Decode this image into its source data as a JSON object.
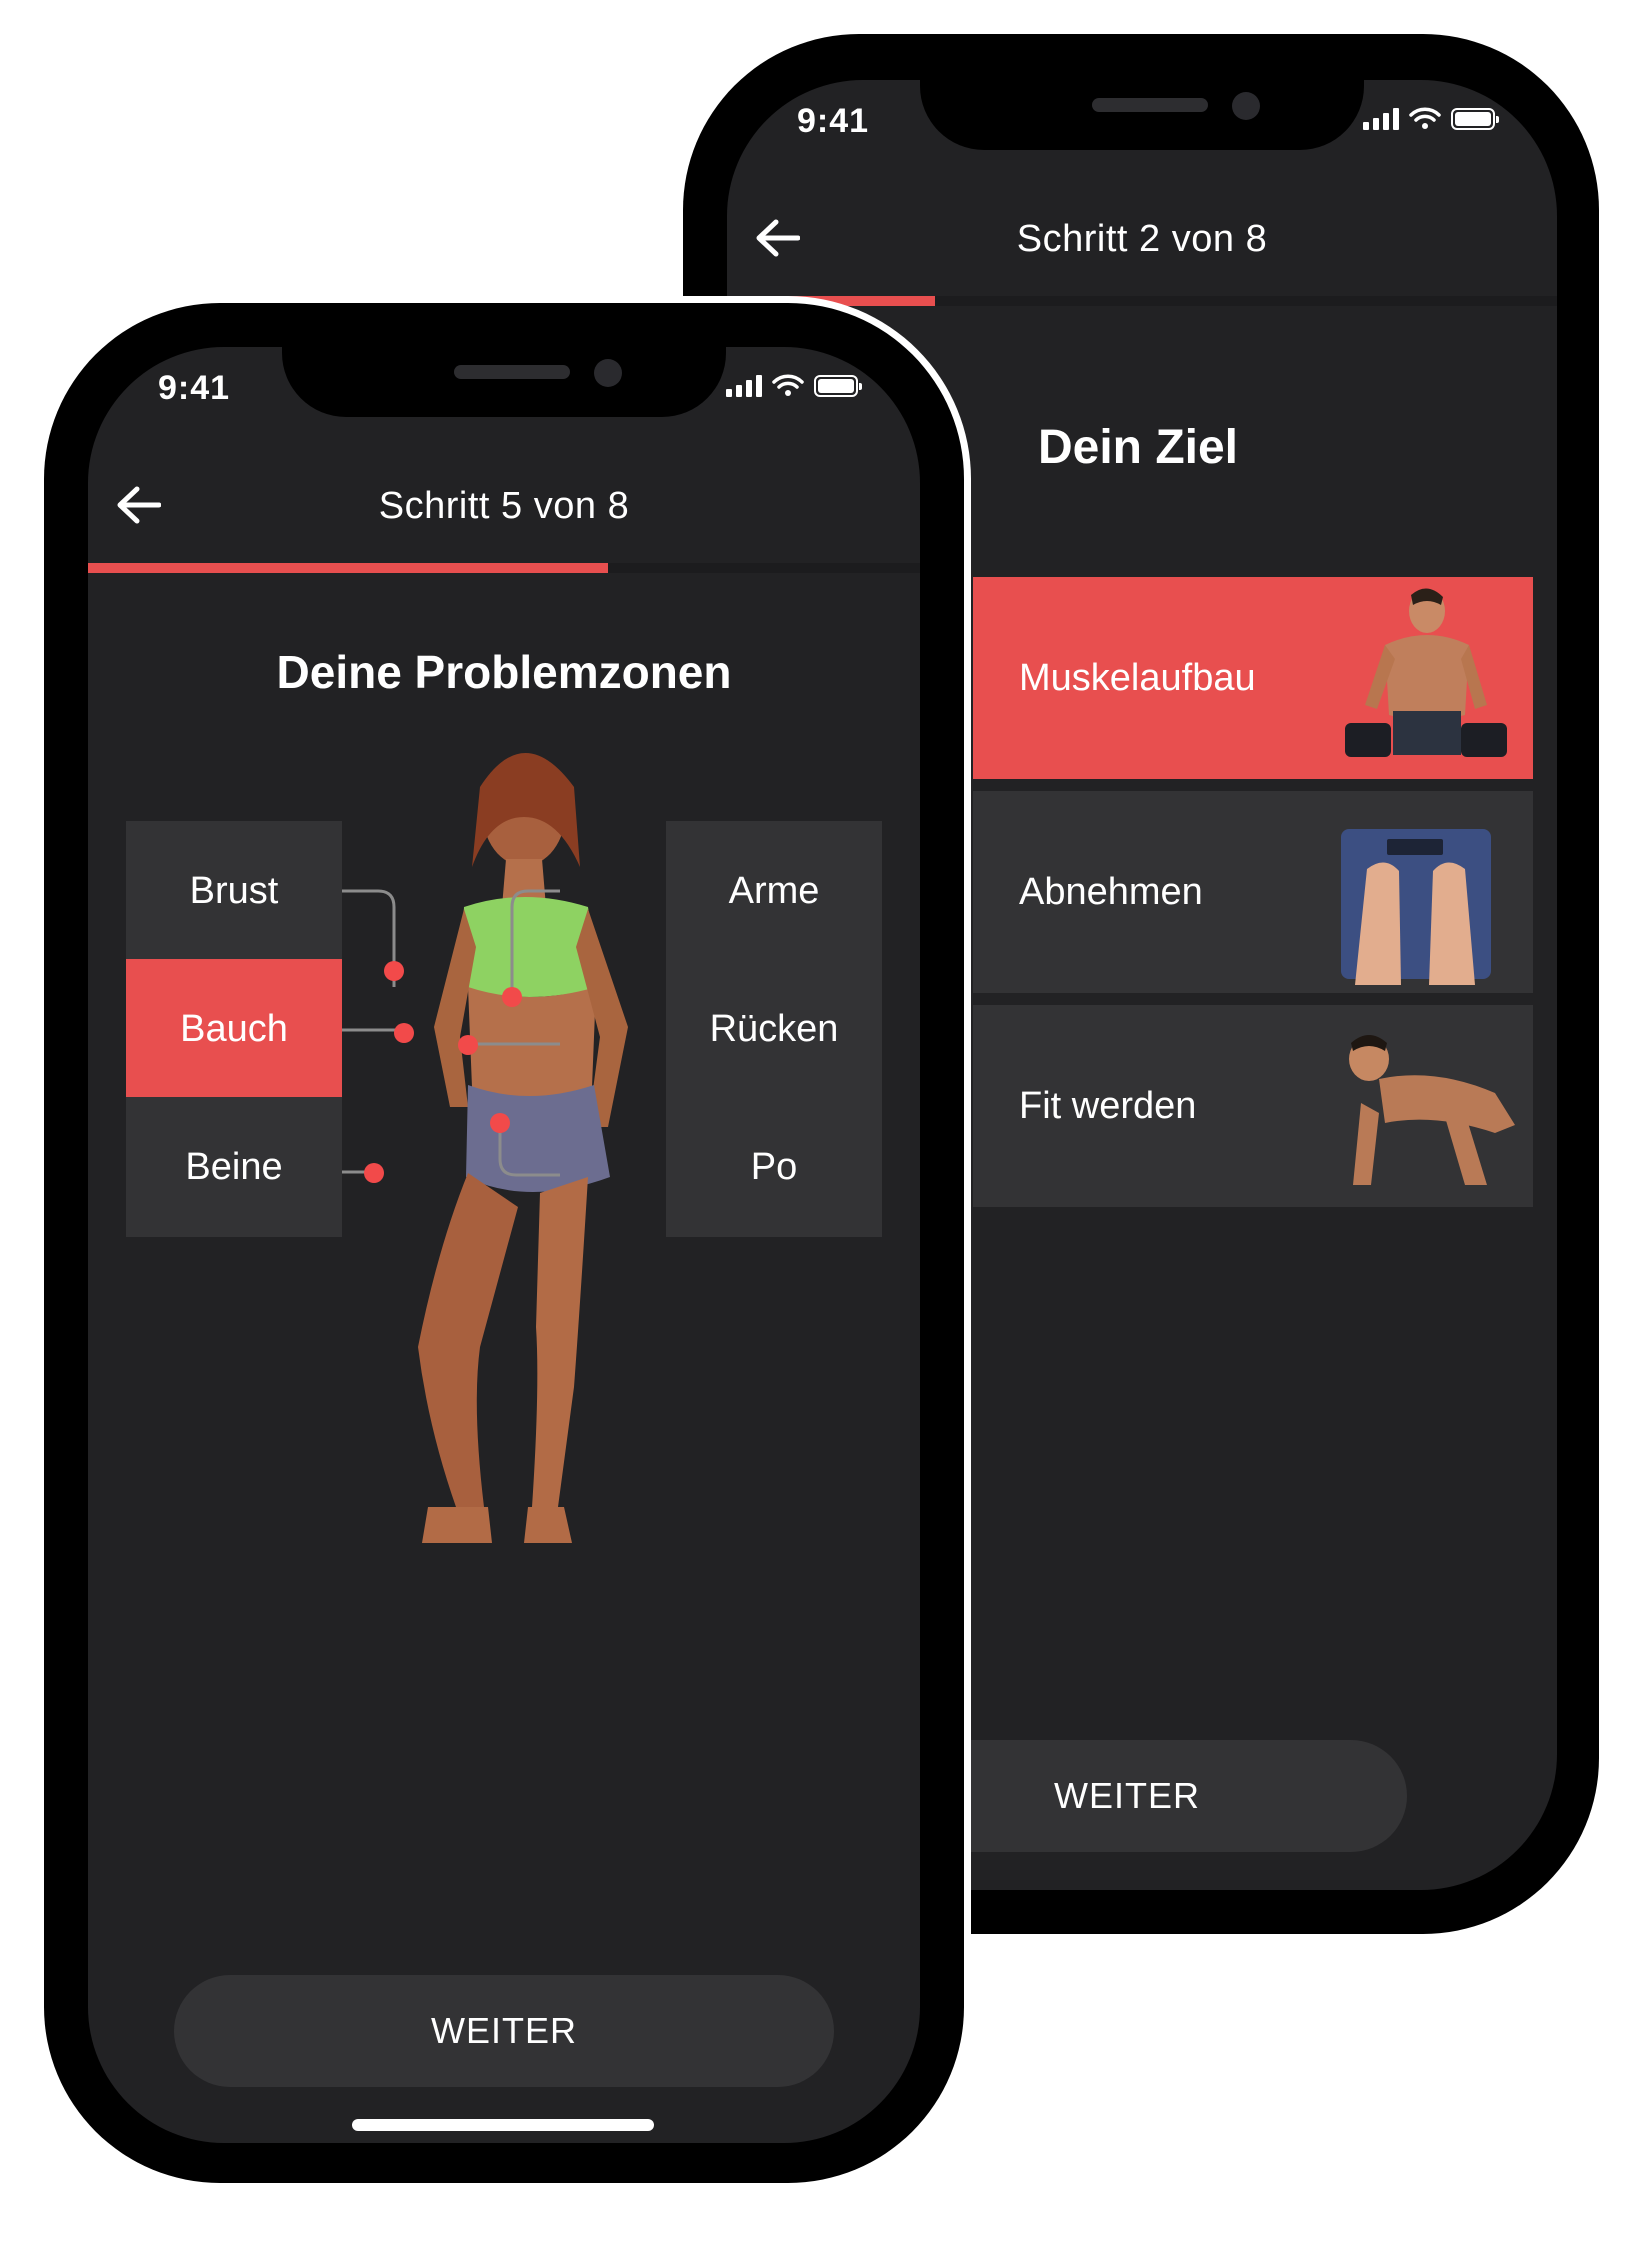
{
  "colors": {
    "accent": "#e84f4f",
    "background": "#222224",
    "card": "#333335"
  },
  "back_phone": {
    "status": {
      "time": "9:41"
    },
    "nav": {
      "title": "Schritt 2 von 8",
      "back_icon": "arrow-left-icon"
    },
    "progress": 0.25,
    "heading": "Dein Ziel",
    "goals": [
      {
        "label": "Muskelaufbau",
        "selected": true,
        "icon": "muscle-man-dumbbells-image"
      },
      {
        "label": "Abnehmen",
        "selected": false,
        "icon": "feet-on-scale-image"
      },
      {
        "label": "Fit werden",
        "selected": false,
        "icon": "man-pushup-image"
      }
    ],
    "cta_label": "WEITER"
  },
  "front_phone": {
    "status": {
      "time": "9:41"
    },
    "nav": {
      "title": "Schritt 5 von 8",
      "back_icon": "arrow-left-icon"
    },
    "progress": 0.625,
    "heading": "Deine Problemzonen",
    "zones": {
      "brust": {
        "label": "Brust",
        "selected": false
      },
      "bauch": {
        "label": "Bauch",
        "selected": true
      },
      "beine": {
        "label": "Beine",
        "selected": false
      },
      "arme": {
        "label": "Arme",
        "selected": false
      },
      "ruecken": {
        "label": "Rücken",
        "selected": false
      },
      "po": {
        "label": "Po",
        "selected": false
      }
    },
    "body_image": "woman-body-illustration",
    "cta_label": "WEITER"
  }
}
